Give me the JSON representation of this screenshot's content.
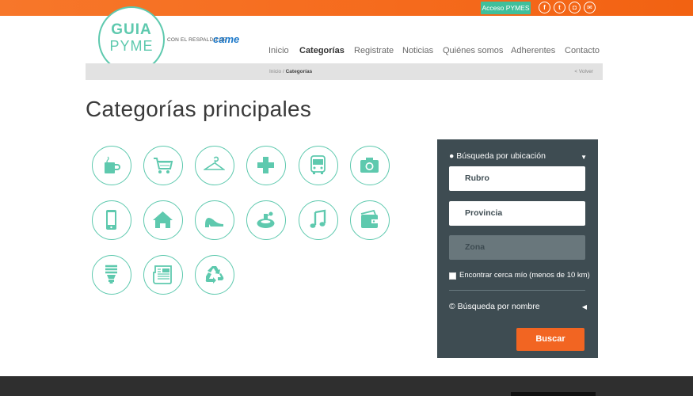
{
  "topbar": {
    "acceso_label": "Acceso PYMES",
    "social": [
      {
        "icon": "facebook-icon",
        "glyph": "f"
      },
      {
        "icon": "twitter-icon",
        "glyph": "t"
      },
      {
        "icon": "instagram-icon",
        "glyph": "◘"
      },
      {
        "icon": "mail-icon",
        "glyph": "✉"
      }
    ]
  },
  "header": {
    "logo_line1": "GUIA",
    "logo_line2": "PYME",
    "respaldo": "CON EL RESPALDO DE",
    "came": "came",
    "nav": [
      "Inicio",
      "Categorías",
      "Registrate",
      "Noticias",
      "Quiénes somos",
      "Adherentes",
      "Contacto"
    ],
    "nav_active": "Categorías"
  },
  "breadcrumb": {
    "home": "Inicio",
    "sep": " / ",
    "current": "Categorías",
    "back": "< Volver"
  },
  "page_title": "Categorías principales",
  "categories": [
    {
      "icon": "coffee-cup-icon"
    },
    {
      "icon": "shopping-cart-icon"
    },
    {
      "icon": "clothes-hanger-icon"
    },
    {
      "icon": "health-cross-icon"
    },
    {
      "icon": "bus-icon"
    },
    {
      "icon": "camera-icon"
    },
    {
      "icon": "mobile-phone-icon"
    },
    {
      "icon": "house-icon"
    },
    {
      "icon": "high-heel-shoe-icon"
    },
    {
      "icon": "perfume-icon"
    },
    {
      "icon": "music-note-icon"
    },
    {
      "icon": "wallet-icon"
    },
    {
      "icon": "light-bulb-icon"
    },
    {
      "icon": "newspaper-icon"
    },
    {
      "icon": "recycle-icon"
    }
  ],
  "search": {
    "location_heading": "Búsqueda por ubicación",
    "rubro": "Rubro",
    "provincia": "Provincia",
    "zona": "Zona",
    "nearby_label": "Encontrar cerca mío (menos de 10 km)",
    "name_heading": "Búsqueda por nombre",
    "buscar_label": "Buscar"
  },
  "colors": {
    "accent": "#5ec9ae",
    "orange": "#f26522",
    "panel": "#3e4c52"
  }
}
